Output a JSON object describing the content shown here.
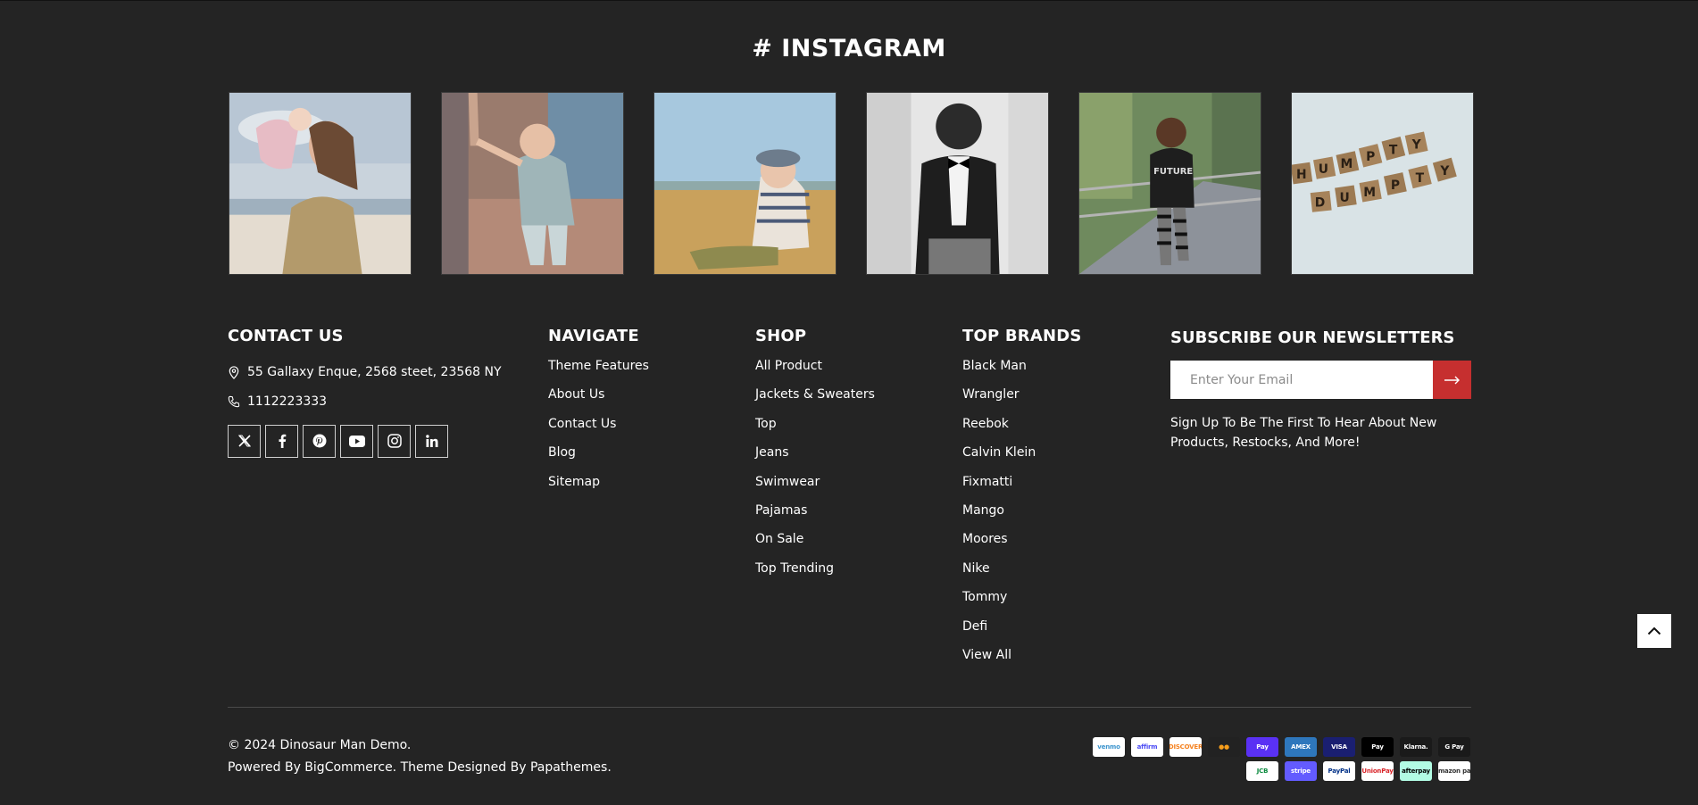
{
  "instagram": {
    "title": "# INSTAGRAM",
    "posts": [
      {
        "subject": "mother-lifting-baby-photo"
      },
      {
        "subject": "toddler-holding-hand-photo"
      },
      {
        "subject": "baby-on-beach-photo"
      },
      {
        "subject": "boy-in-bowtie-photo"
      },
      {
        "subject": "girl-on-bridge-photo"
      },
      {
        "subject": "humpty-dumpty-tiles-photo"
      }
    ]
  },
  "contact": {
    "heading": "CONTACT US",
    "address": "55 Gallaxy Enque, 2568 steet, 23568 NY",
    "phone": "1112223333",
    "socials": [
      "x-icon",
      "facebook-icon",
      "pinterest-icon",
      "youtube-icon",
      "instagram-icon",
      "linkedin-icon"
    ]
  },
  "navigate": {
    "heading": "NAVIGATE",
    "items": [
      "Theme Features",
      "About Us",
      "Contact Us",
      "Blog",
      "Sitemap"
    ]
  },
  "shop": {
    "heading": "SHOP",
    "items": [
      "All Product",
      "Jackets & Sweaters",
      "Top",
      "Jeans",
      "Swimwear",
      "Pajamas",
      "On Sale",
      "Top Trending"
    ]
  },
  "brands": {
    "heading": "TOP BRANDS",
    "items": [
      "Black Man",
      "Wrangler",
      "Reebok",
      "Calvin Klein",
      "Fixmatti",
      "Mango",
      "Moores",
      "Nike",
      "Tommy",
      "Defi",
      "View All"
    ]
  },
  "newsletter": {
    "heading": "SUBSCRIBE OUR NEWSLETTERS",
    "placeholder": "Enter Your Email",
    "note": "Sign Up To Be The First To Hear About New Products, Restocks, And More!"
  },
  "footer": {
    "copyright": "© 2024 Dinosaur Man Demo.",
    "powered": "Powered By BigCommerce. Theme Designed By Papathemes."
  },
  "payments": {
    "row1": [
      {
        "label": "venmo",
        "bg": "#ffffff",
        "fg": "#3d95ce"
      },
      {
        "label": "affirm",
        "bg": "#ffffff",
        "fg": "#4a4af4"
      },
      {
        "label": "DISCOVER",
        "bg": "#ffffff",
        "fg": "#f58220"
      },
      {
        "label": "●●",
        "bg": "#222222",
        "fg": "#f79e1b"
      },
      {
        "label": "Pay",
        "bg": "#5a31f4",
        "fg": "#ffffff"
      },
      {
        "label": "AMEX",
        "bg": "#2e77bc",
        "fg": "#ffffff"
      },
      {
        "label": "VISA",
        "bg": "#1a1f71",
        "fg": "#ffffff"
      },
      {
        "label": "Pay",
        "bg": "#000000",
        "fg": "#ffffff"
      },
      {
        "label": "Klarna.",
        "bg": "#1a1a1a",
        "fg": "#ffffff"
      },
      {
        "label": "G Pay",
        "bg": "#1a1a1a",
        "fg": "#ffffff"
      }
    ],
    "row2": [
      {
        "label": "JCB",
        "bg": "#ffffff",
        "fg": "#0b8a3e"
      },
      {
        "label": "stripe",
        "bg": "#635bff",
        "fg": "#ffffff"
      },
      {
        "label": "PayPal",
        "bg": "#ffffff",
        "fg": "#003087"
      },
      {
        "label": "UnionPay",
        "bg": "#ffffff",
        "fg": "#d9252a"
      },
      {
        "label": "afterpay",
        "bg": "#b2fce4",
        "fg": "#000000"
      },
      {
        "label": "amazon pay",
        "bg": "#ffffff",
        "fg": "#333333"
      }
    ]
  }
}
